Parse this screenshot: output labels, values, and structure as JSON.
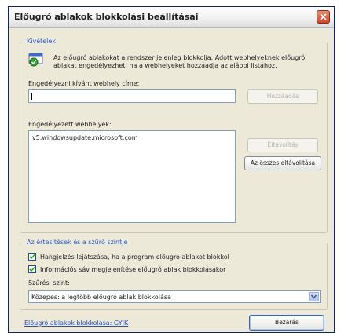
{
  "window": {
    "title": "Előugró ablakok blokkolási beállításai"
  },
  "exceptions": {
    "group_label": "Kivételek",
    "description_line1": "Az előugró ablakokat a rendszer jelenleg blokkolja. Adott webhelyeknek előugró",
    "description_line2": "ablakat engedélyezhet, ha a webhelyeket hozzáadja az alábbi listához.",
    "address_label": "Engedélyezni kívánt webhely címe:",
    "address_value": "",
    "add_button": "Hozzáadás",
    "allowed_label": "Engedélyezett webhelyek:",
    "allowed_sites": [
      "v5.windowsupdate.microsoft.com"
    ],
    "remove_button": "Eltávolítás",
    "remove_all_button": "Az összes eltávolítása"
  },
  "notifications": {
    "group_label": "Az értesítések és a szűrő szintje",
    "play_sound_label": "Hangjelzés lejátszása, ha a program előugró ablakot blokkol",
    "play_sound_checked": true,
    "show_infobar_label": "Információs sáv megjelenítése előugró ablak blokkolásakor",
    "show_infobar_checked": true,
    "filter_level_label": "Szűrési szint:",
    "filter_level_value": "Közepes: a legtöbb előugró ablak blokkolása"
  },
  "footer": {
    "help_link": "Előugró ablakok blokkolása: GYIK",
    "close_button": "Bezárás"
  }
}
